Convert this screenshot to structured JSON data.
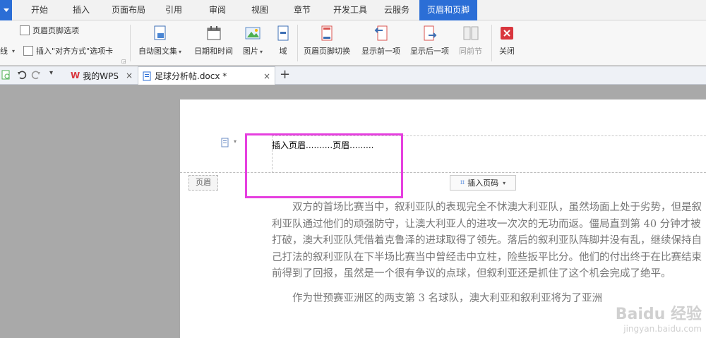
{
  "menu": {
    "tabs": [
      "开始",
      "插入",
      "页面布局",
      "引用",
      "审阅",
      "视图",
      "章节",
      "开发工具",
      "云服务",
      "页眉和页脚"
    ],
    "active": "页眉和页脚"
  },
  "ribbon": {
    "opt1": "页眉页脚选项",
    "opt2_prefix": "线",
    "opt2": "插入\"对齐方式\"选项卡",
    "auto_text": "自动图文集",
    "date_time": "日期和时间",
    "picture": "图片",
    "field": "域",
    "switch": "页眉页脚切换",
    "show_prev": "显示前一项",
    "show_next": "显示后一项",
    "same_prev": "同前节",
    "close": "关闭"
  },
  "tabs": {
    "wps": "我的WPS",
    "doc": "足球分析帖.docx *",
    "add": "+",
    "close": "×"
  },
  "document": {
    "header_text": "插入页眉..........页眉.........",
    "header_label": "页眉",
    "insert_page_no": "插入页码",
    "para1": "双方的首场比赛当中，叙利亚队的表现完全不怵澳大利亚队，虽然场面上处于劣势，但是叙利亚队通过他们的顽强防守，让澳大利亚人的进攻一次次的无功而返。僵局直到第 40 分钟才被打破，澳大利亚队凭借着克鲁泽的进球取得了领先。落后的叙利亚队阵脚并没有乱，继续保持自己打法的叙利亚队在下半场比赛当中曾经击中立柱，险些扳平比分。他们的付出终于在比赛结束前得到了回报，虽然是一个很有争议的点球，但叙利亚还是抓住了这个机会完成了绝平。",
    "para2": "作为世预赛亚洲区的两支第 3 名球队，澳大利亚和叙利亚将为了亚洲"
  },
  "watermark": {
    "title": "Baidu 经验",
    "sub": "jingyan.baidu.com"
  },
  "colors": {
    "accent": "#2b6ed6",
    "highlight": "#e63fdf"
  }
}
